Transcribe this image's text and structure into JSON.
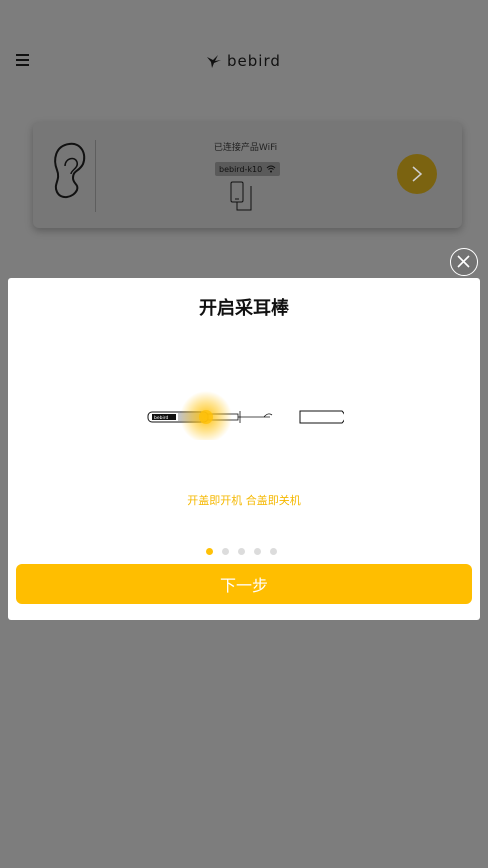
{
  "header": {
    "menu_icon": "hamburger-menu-icon",
    "logo_text": "bebird"
  },
  "device_card": {
    "status_text": "已连接产品WiFi",
    "wifi_name": "bebird-k10",
    "icons": [
      "ear-icon",
      "wifi-icon",
      "phone-icon",
      "chevron-right-icon"
    ]
  },
  "modal": {
    "title": "开启采耳棒",
    "instruction": "开盖即开机 合盖即关机",
    "dots_total": 5,
    "dots_active": 1,
    "next_button": "下一步",
    "close_icon": "close-icon"
  },
  "colors": {
    "accent": "#ffbe00",
    "overlay": "#7d7d7d",
    "modal_bg": "#ffffff"
  }
}
